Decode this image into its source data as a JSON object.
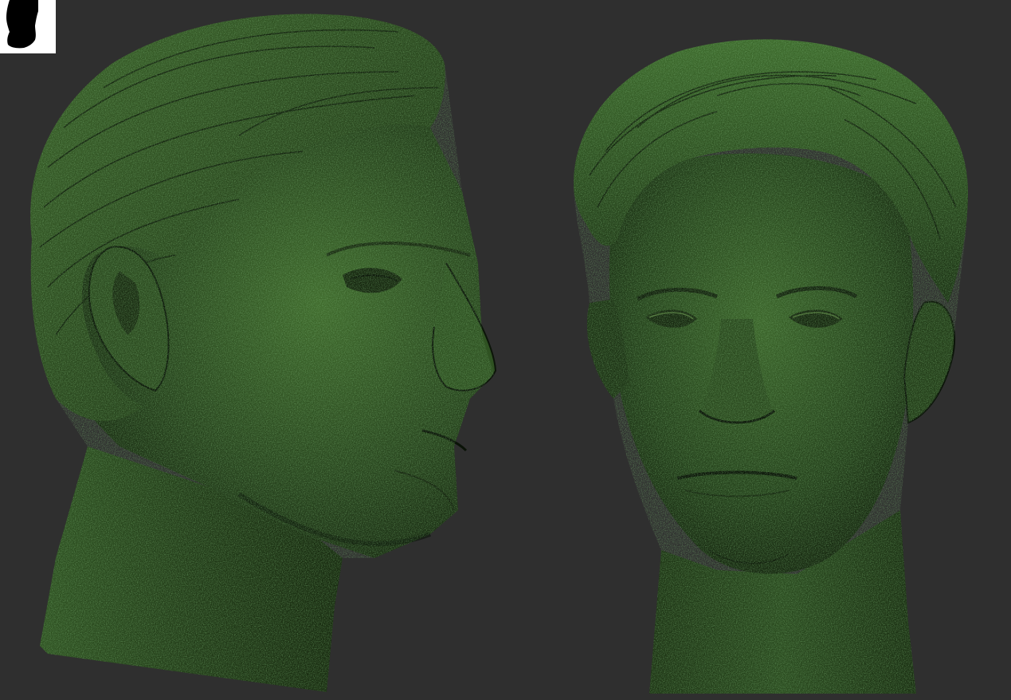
{
  "app": {
    "window_title": ""
  },
  "viewport": {
    "background_color": "#2f2f2f",
    "material_color": "#2d4a22",
    "material_highlight": "#4f7a34",
    "material_shadow": "#0c1409"
  },
  "navigator": {
    "background_color": "#ffffff",
    "silhouette_color": "#000000",
    "icon": "head-silhouette-icon"
  },
  "models": [
    {
      "name": "head-profile-view",
      "view": "three-quarter-left"
    },
    {
      "name": "head-front-view",
      "view": "front"
    }
  ]
}
